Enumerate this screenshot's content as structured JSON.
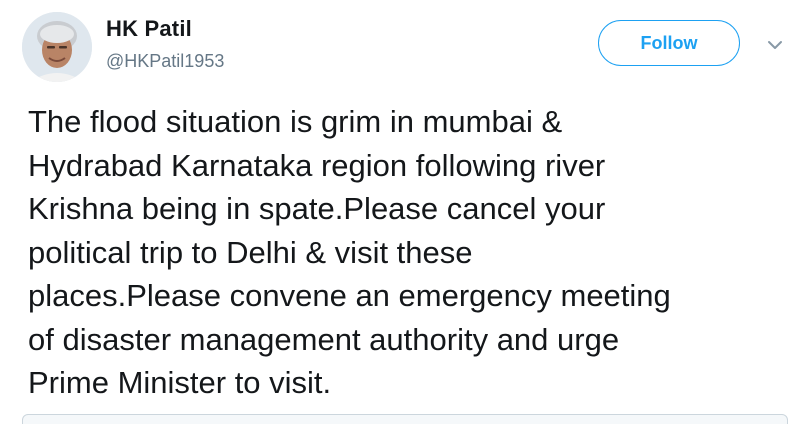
{
  "author": {
    "display_name": "HK Patil",
    "handle": "@HKPatil1953",
    "avatar_icon": "profile-photo"
  },
  "follow_button": {
    "label": "Follow"
  },
  "menu": {
    "icon": "chevron-down-icon"
  },
  "tweet": {
    "text": "The flood situation is grim in mumbai &\nHydrabad Karnataka region following river\nKrishna being in spate.Please cancel your\npolitical trip to Delhi & visit these\nplaces.Please convene an emergency meeting\nof disaster management authority and urge\nPrime Minister to visit."
  },
  "colors": {
    "accent": "#1da1f2",
    "text_primary": "#14171a",
    "text_secondary": "#657786",
    "border": "#ccd6dd"
  }
}
